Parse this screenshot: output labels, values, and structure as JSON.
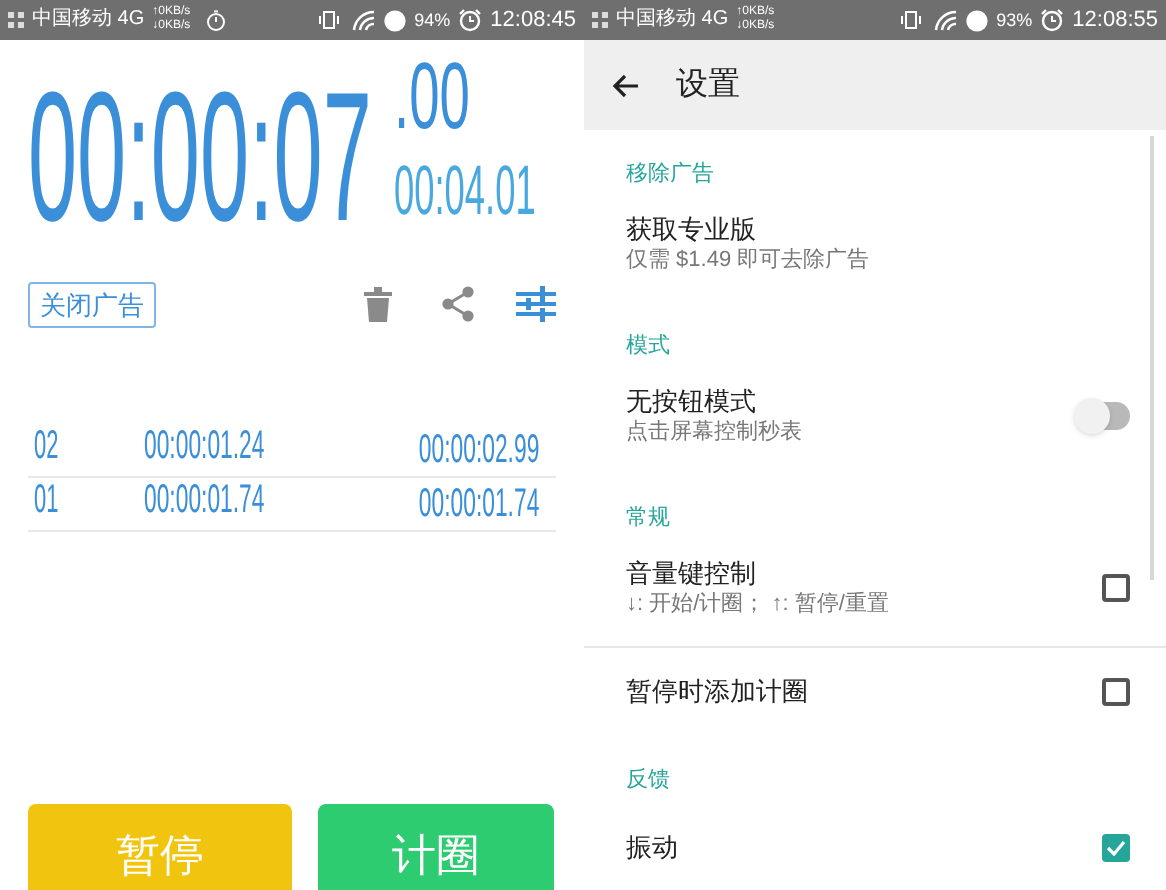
{
  "stopwatch_screen": {
    "status_bar": {
      "carrier": "中国移动 4G",
      "upload": "↑0KB/s",
      "download": "↓0KB/s",
      "stopwatch_indicator": true,
      "battery": "94%",
      "time": "12:08:45"
    },
    "timer": {
      "main": "00:00:07",
      "fraction": ".00",
      "lap_time": "00:04.01"
    },
    "remove_ads_button": "关闭广告",
    "laps": [
      {
        "number": "02",
        "lap": "00:00:01.24",
        "total": "00:00:02.99"
      },
      {
        "number": "01",
        "lap": "00:00:01.74",
        "total": "00:00:01.74"
      }
    ],
    "buttons": [
      {
        "label": "暂停",
        "kind": "pause"
      },
      {
        "label": "计圈",
        "kind": "lap"
      }
    ]
  },
  "settings_screen": {
    "status_bar": {
      "carrier": "中国移动 4G",
      "upload": "↑0KB/s",
      "download": "↓0KB/s",
      "stopwatch_indicator": false,
      "battery": "93%",
      "time": "12:08:55"
    },
    "title": "设置",
    "sections": [
      {
        "title": "移除广告",
        "items": [
          {
            "kind": "link",
            "title": "获取专业版",
            "subtitle": "仅需 $1.49 即可去除广告"
          }
        ]
      },
      {
        "title": "模式",
        "items": [
          {
            "kind": "toggle",
            "title": "无按钮模式",
            "subtitle": "点击屏幕控制秒表",
            "on": false
          }
        ]
      },
      {
        "title": "常规",
        "items": [
          {
            "kind": "checkbox",
            "title": "音量键控制",
            "subtitle": "↓: 开始/计圈； ↑: 暂停/重置",
            "checked": false
          },
          {
            "kind": "checkbox",
            "title": "暂停时添加计圈",
            "checked": false
          }
        ]
      },
      {
        "title": "反馈",
        "items": [
          {
            "kind": "checkbox",
            "title": "振动",
            "checked": true
          }
        ]
      }
    ]
  }
}
